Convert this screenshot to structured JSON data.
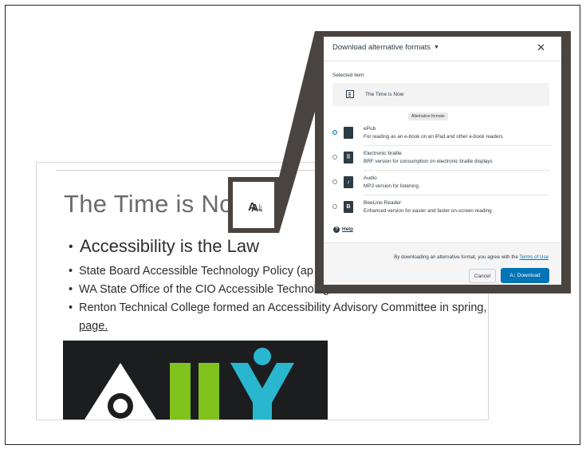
{
  "page": {
    "title": "The Time is No",
    "alt_format_glyph": "A↓",
    "heading_bullet": "Accessibility is the Law",
    "bullets": [
      "State Board Accessible Technology Policy (ap",
      "WA State Office of the CIO Accessible Technolog",
      "Renton Technical College formed an Accessibility Advisory Committee in spring,"
    ],
    "bullet_continuation": "page."
  },
  "zoom_glyph": "A↓",
  "dialog": {
    "title": "Download alternative formats",
    "close_icon": "close-icon",
    "selected_label": "Selected item:",
    "selected_name": "The Time is Now",
    "alt_tag": "Alternative formats",
    "formats": [
      {
        "name": "ePub",
        "desc": "For reading as an e-book on an iPad and other e-book readers",
        "selected": true,
        "icon": "book-icon"
      },
      {
        "name": "Electronic braille",
        "desc": "BRF version for consumption on electronic braille displays",
        "selected": false,
        "icon": "braille-icon"
      },
      {
        "name": "Audio",
        "desc": "MP3 version for listening",
        "selected": false,
        "icon": "audio-icon"
      },
      {
        "name": "BeeLine Reader",
        "desc": "Enhanced version for easier and faster on-screen reading",
        "selected": false,
        "icon": "beeline-icon"
      }
    ],
    "help_label": "Help",
    "terms_prefix": "By downloading an alternative format, you agree with the",
    "terms_link": "Terms of Use",
    "cancel_label": "Cancel",
    "download_label": "A↓ Download"
  },
  "colors": {
    "accent": "#0374b5",
    "callout": "#4a4441",
    "text": "#2d3b45"
  }
}
